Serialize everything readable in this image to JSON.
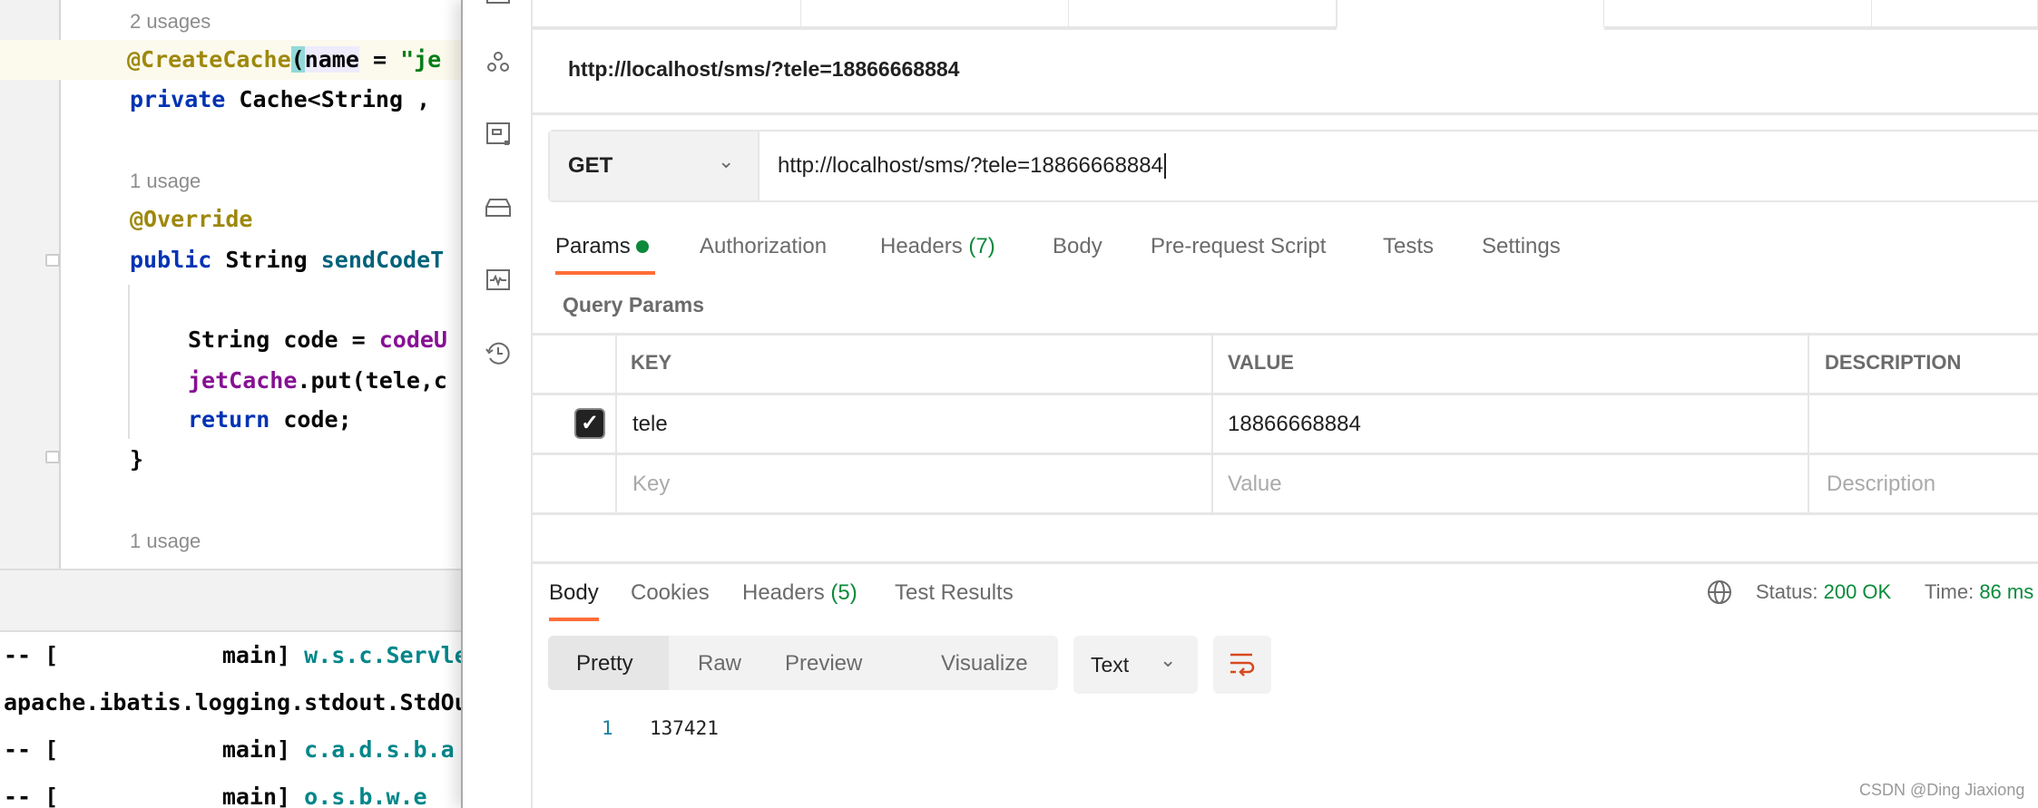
{
  "editor": {
    "lines": [
      {
        "hint": "2 usages"
      },
      {
        "ann": "@CreateCache",
        "paren": "(",
        "name": "name",
        "eq": " = ",
        "str": "\"je"
      },
      {
        "kw": "private",
        "rest": " Cache<String ,"
      },
      {
        "hint": "1 usage"
      },
      {
        "ann": "@Override"
      },
      {
        "kw": "public",
        "rest": " String ",
        "fn": "sendCodeT"
      },
      {
        "rest": "String code = ",
        "fld": "codeU"
      },
      {
        "fld": "jetCache",
        "rest": ".put(tele,c"
      },
      {
        "kw": "return",
        "rest": " code;"
      },
      {
        "rest": "}"
      },
      {
        "hint": "1 usage"
      }
    ]
  },
  "console": {
    "lines": [
      {
        "plain": "-- [            main] ",
        "teal": "w.s.c.ServletW"
      },
      {
        "plain": "apache.ibatis.logging.stdout.StdOut",
        "teal": ""
      },
      {
        "plain": "-- [            main] ",
        "teal": "c.a.d.s.b.a"
      },
      {
        "plain": "-- [            main] ",
        "teal": "o.s.b.w.e"
      }
    ]
  },
  "sidebar": {
    "icons": [
      "apis-icon",
      "mock-server-icon",
      "environments-icon",
      "monitor-icon",
      "history-icon"
    ]
  },
  "request": {
    "name": "http://localhost/sms/?tele=18866668884",
    "method": "GET",
    "url": "http://localhost/sms/?tele=18866668884",
    "tabs": [
      {
        "label": "Params",
        "active": true
      },
      {
        "label": "Authorization"
      },
      {
        "label": "Headers",
        "count": "(7)"
      },
      {
        "label": "Body"
      },
      {
        "label": "Pre-request Script"
      },
      {
        "label": "Tests"
      },
      {
        "label": "Settings"
      }
    ],
    "query_title": "Query Params",
    "columns": [
      "KEY",
      "VALUE",
      "DESCRIPTION"
    ],
    "rows": [
      {
        "checked": true,
        "key": "tele",
        "value": "18866668884",
        "description": ""
      }
    ],
    "placeholders": {
      "key": "Key",
      "value": "Value",
      "description": "Description"
    }
  },
  "response": {
    "tabs": [
      {
        "label": "Body",
        "active": true
      },
      {
        "label": "Cookies"
      },
      {
        "label": "Headers",
        "count": "(5)"
      },
      {
        "label": "Test Results"
      }
    ],
    "status_label": "Status:",
    "status_value": "200 OK",
    "time_label": "Time:",
    "time_value": "86 ms",
    "views": [
      "Pretty",
      "Raw",
      "Preview",
      "Visualize"
    ],
    "format": "Text",
    "body": [
      {
        "num": "1",
        "text": "137421"
      }
    ]
  },
  "colors": {
    "accent": "#ff6c37",
    "success": "#0a8a3a"
  },
  "watermark": "CSDN @Ding Jiaxiong"
}
